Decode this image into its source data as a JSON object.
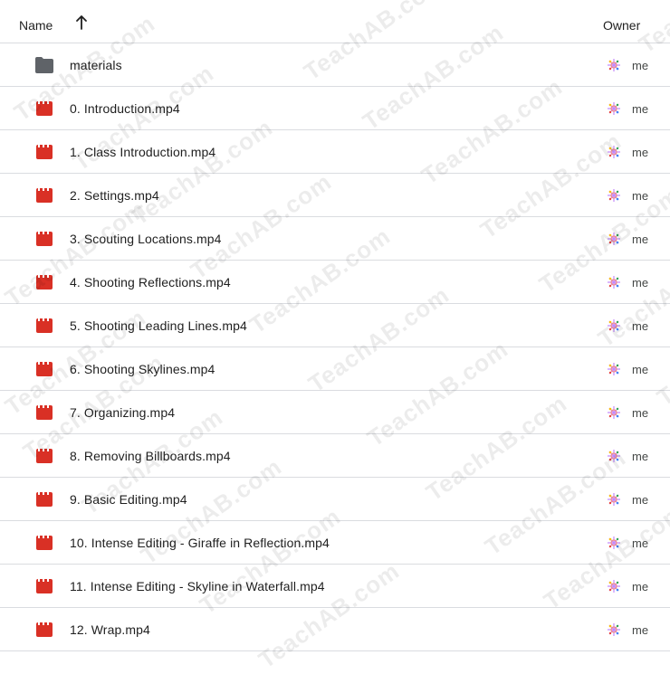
{
  "header": {
    "name_label": "Name",
    "sort_icon": "arrow-up-icon",
    "owner_label": "Owner"
  },
  "files": [
    {
      "name": "materials",
      "type": "folder",
      "owner": "me"
    },
    {
      "name": "0. Introduction.mp4",
      "type": "video",
      "owner": "me"
    },
    {
      "name": "1. Class Introduction.mp4",
      "type": "video",
      "owner": "me"
    },
    {
      "name": "2. Settings.mp4",
      "type": "video",
      "owner": "me"
    },
    {
      "name": "3. Scouting Locations.mp4",
      "type": "video",
      "owner": "me"
    },
    {
      "name": "4. Shooting Reflections.mp4",
      "type": "video",
      "owner": "me"
    },
    {
      "name": "5. Shooting Leading Lines.mp4",
      "type": "video",
      "owner": "me"
    },
    {
      "name": "6. Shooting Skylines.mp4",
      "type": "video",
      "owner": "me"
    },
    {
      "name": "7. Organizing.mp4",
      "type": "video",
      "owner": "me"
    },
    {
      "name": "8. Removing Billboards.mp4",
      "type": "video",
      "owner": "me"
    },
    {
      "name": "9. Basic Editing.mp4",
      "type": "video",
      "owner": "me"
    },
    {
      "name": "10. Intense Editing - Giraffe in Reflection.mp4",
      "type": "video",
      "owner": "me"
    },
    {
      "name": "11. Intense Editing - Skyline in Waterfall.mp4",
      "type": "video",
      "owner": "me"
    },
    {
      "name": "12. Wrap.mp4",
      "type": "video",
      "owner": "me"
    }
  ],
  "watermark": "TeachAB.com",
  "colors": {
    "folder": "#5f6368",
    "video": "#d93025",
    "divider": "#dadce0"
  }
}
